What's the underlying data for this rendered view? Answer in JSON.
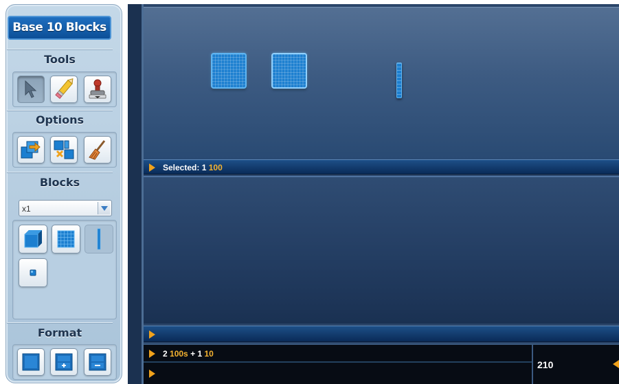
{
  "app": {
    "title": "Base 10 Blocks"
  },
  "sidebar": {
    "tools_title": "Tools",
    "options_title": "Options",
    "blocks_title": "Blocks",
    "format_title": "Format",
    "tools": [
      {
        "name": "select-tool",
        "icon": "arrow-pointer-icon",
        "active": true
      },
      {
        "name": "eraser-tool",
        "icon": "eraser-pencil-icon",
        "active": false
      },
      {
        "name": "stamp-tool",
        "icon": "stamp-icon",
        "active": false
      }
    ],
    "options": [
      {
        "name": "regroup-option",
        "icon": "regroup-arrow-icon"
      },
      {
        "name": "break-apart-option",
        "icon": "break-apart-icon"
      },
      {
        "name": "clear-option",
        "icon": "broom-icon"
      }
    ],
    "block_multiplier": {
      "selected": "x1"
    },
    "block_types": [
      {
        "name": "thousand-cube",
        "icon": "thousand-cube-icon",
        "enabled": true
      },
      {
        "name": "hundred-flat",
        "icon": "hundred-flat-icon",
        "enabled": true
      },
      {
        "name": "ten-rod",
        "icon": "ten-rod-icon",
        "enabled": false
      },
      {
        "name": "one-unit",
        "icon": "one-unit-icon",
        "enabled": true
      }
    ],
    "formats": [
      {
        "name": "format-single",
        "icon": "single-pane-icon"
      },
      {
        "name": "format-add",
        "icon": "add-pane-icon"
      },
      {
        "name": "format-subtract",
        "icon": "subtract-pane-icon"
      }
    ]
  },
  "workspace": {
    "selected_bar": {
      "label": "Selected:",
      "count": "1",
      "value": "100"
    },
    "equation": {
      "count_a": "2",
      "unit_a": "100s",
      "plus": "+",
      "count_b": "1",
      "unit_b": "10"
    },
    "total": "210"
  },
  "colors": {
    "accent_gold": "#f5b330",
    "block_blue": "#1c7fd0",
    "title_blue": "#0c4f97"
  }
}
